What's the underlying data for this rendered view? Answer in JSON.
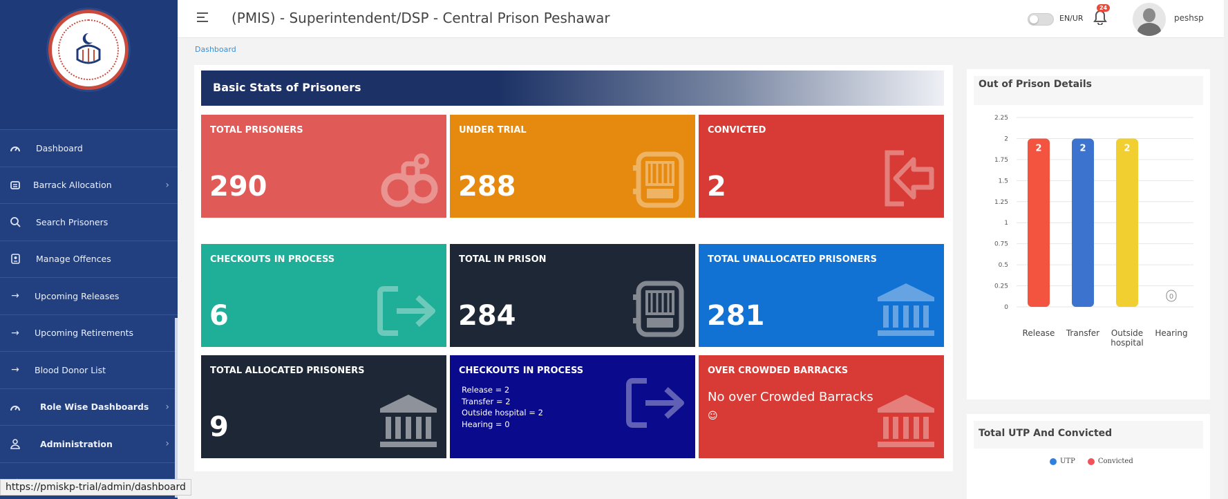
{
  "sidebar": {
    "items": [
      {
        "label": "Dashboard"
      },
      {
        "label": "Barrack Allocation"
      },
      {
        "label": "Search Prisoners"
      },
      {
        "label": "Manage Offences"
      },
      {
        "label": "Upcoming Releases"
      },
      {
        "label": "Upcoming Retirements"
      },
      {
        "label": "Blood Donor List"
      },
      {
        "label": "Role Wise Dashboards"
      },
      {
        "label": "Administration"
      }
    ]
  },
  "header": {
    "title": "(PMIS) - Superintendent/DSP - Central Prison Peshawar",
    "lang": "EN/UR",
    "notif_count": "24",
    "username": "peshsp"
  },
  "breadcrumb": "Dashboard",
  "main": {
    "banner": "Basic Stats of Prisoners",
    "tiles": [
      {
        "title": "TOTAL PRISONERS",
        "value": "290",
        "color": "#e05a57",
        "icon": "handcuffs-icon"
      },
      {
        "title": "UNDER TRIAL",
        "value": "288",
        "color": "#e58a0f",
        "icon": "jail-cell-icon"
      },
      {
        "title": "CONVICTED",
        "value": "2",
        "color": "#d83b35",
        "icon": "sign-in-icon"
      },
      {
        "title": "CHECKOUTS IN PROCESS",
        "value": "6",
        "color": "#1fae97",
        "icon": "sign-out-icon"
      },
      {
        "title": "TOTAL IN PRISON",
        "value": "284",
        "color": "#1d2736",
        "icon": "jail-cell-icon"
      },
      {
        "title": "TOTAL UNALLOCATED PRISONERS",
        "value": "281",
        "color": "#1272d3",
        "icon": "institution-icon"
      },
      {
        "title": "TOTAL ALLOCATED PRISONERS",
        "value": "9",
        "color": "#1d2736",
        "icon": "institution-icon"
      },
      {
        "title": "CHECKOUTS IN PROCESS",
        "lines": [
          "Release = 2",
          "Transfer = 2",
          "Outside hospital = 2",
          "Hearing = 0"
        ],
        "color": "#0a0a8c",
        "icon": "sign-out-icon"
      },
      {
        "title": "OVER CROWDED BARRACKS",
        "text": "No over Crowded Barracks",
        "emoji": "☺",
        "color": "#d83b35",
        "icon": "institution-icon"
      }
    ]
  },
  "out_of_prison": {
    "title": "Out of Prison Details"
  },
  "utp_convicted": {
    "title": "Total UTP And Convicted",
    "legend": [
      {
        "name": "UTP",
        "color": "#2f7fe0"
      },
      {
        "name": "Convicted",
        "color": "#f0535a"
      }
    ]
  },
  "status_url": "https://pmiskp-trial/admin/dashboard",
  "chart_data": {
    "type": "bar",
    "title": "Out of Prison Details",
    "categories": [
      "Release",
      "Transfer",
      "Outside hospital",
      "Hearing"
    ],
    "values": [
      2,
      2,
      2,
      0
    ],
    "colors": [
      "#f25440",
      "#3b73cf",
      "#f2cf30",
      "#999999"
    ],
    "ylim": [
      0,
      2.25
    ],
    "yticks": [
      "0",
      "0.25",
      "0.5",
      "0.75",
      "1",
      "1.25",
      "1.5",
      "1.75",
      "2",
      "2.25"
    ],
    "grid": true
  }
}
